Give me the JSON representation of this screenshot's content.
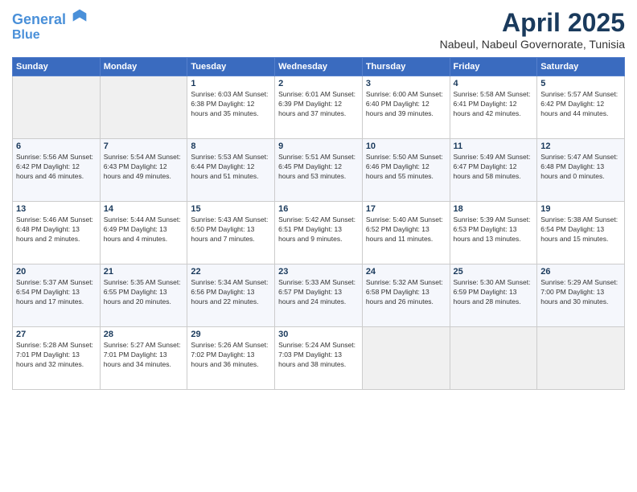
{
  "header": {
    "logo_line1": "General",
    "logo_line2": "Blue",
    "title": "April 2025",
    "subtitle": "Nabeul, Nabeul Governorate, Tunisia"
  },
  "days_of_week": [
    "Sunday",
    "Monday",
    "Tuesday",
    "Wednesday",
    "Thursday",
    "Friday",
    "Saturday"
  ],
  "weeks": [
    [
      {
        "num": "",
        "info": ""
      },
      {
        "num": "",
        "info": ""
      },
      {
        "num": "1",
        "info": "Sunrise: 6:03 AM\nSunset: 6:38 PM\nDaylight: 12 hours\nand 35 minutes."
      },
      {
        "num": "2",
        "info": "Sunrise: 6:01 AM\nSunset: 6:39 PM\nDaylight: 12 hours\nand 37 minutes."
      },
      {
        "num": "3",
        "info": "Sunrise: 6:00 AM\nSunset: 6:40 PM\nDaylight: 12 hours\nand 39 minutes."
      },
      {
        "num": "4",
        "info": "Sunrise: 5:58 AM\nSunset: 6:41 PM\nDaylight: 12 hours\nand 42 minutes."
      },
      {
        "num": "5",
        "info": "Sunrise: 5:57 AM\nSunset: 6:42 PM\nDaylight: 12 hours\nand 44 minutes."
      }
    ],
    [
      {
        "num": "6",
        "info": "Sunrise: 5:56 AM\nSunset: 6:42 PM\nDaylight: 12 hours\nand 46 minutes."
      },
      {
        "num": "7",
        "info": "Sunrise: 5:54 AM\nSunset: 6:43 PM\nDaylight: 12 hours\nand 49 minutes."
      },
      {
        "num": "8",
        "info": "Sunrise: 5:53 AM\nSunset: 6:44 PM\nDaylight: 12 hours\nand 51 minutes."
      },
      {
        "num": "9",
        "info": "Sunrise: 5:51 AM\nSunset: 6:45 PM\nDaylight: 12 hours\nand 53 minutes."
      },
      {
        "num": "10",
        "info": "Sunrise: 5:50 AM\nSunset: 6:46 PM\nDaylight: 12 hours\nand 55 minutes."
      },
      {
        "num": "11",
        "info": "Sunrise: 5:49 AM\nSunset: 6:47 PM\nDaylight: 12 hours\nand 58 minutes."
      },
      {
        "num": "12",
        "info": "Sunrise: 5:47 AM\nSunset: 6:48 PM\nDaylight: 13 hours\nand 0 minutes."
      }
    ],
    [
      {
        "num": "13",
        "info": "Sunrise: 5:46 AM\nSunset: 6:48 PM\nDaylight: 13 hours\nand 2 minutes."
      },
      {
        "num": "14",
        "info": "Sunrise: 5:44 AM\nSunset: 6:49 PM\nDaylight: 13 hours\nand 4 minutes."
      },
      {
        "num": "15",
        "info": "Sunrise: 5:43 AM\nSunset: 6:50 PM\nDaylight: 13 hours\nand 7 minutes."
      },
      {
        "num": "16",
        "info": "Sunrise: 5:42 AM\nSunset: 6:51 PM\nDaylight: 13 hours\nand 9 minutes."
      },
      {
        "num": "17",
        "info": "Sunrise: 5:40 AM\nSunset: 6:52 PM\nDaylight: 13 hours\nand 11 minutes."
      },
      {
        "num": "18",
        "info": "Sunrise: 5:39 AM\nSunset: 6:53 PM\nDaylight: 13 hours\nand 13 minutes."
      },
      {
        "num": "19",
        "info": "Sunrise: 5:38 AM\nSunset: 6:54 PM\nDaylight: 13 hours\nand 15 minutes."
      }
    ],
    [
      {
        "num": "20",
        "info": "Sunrise: 5:37 AM\nSunset: 6:54 PM\nDaylight: 13 hours\nand 17 minutes."
      },
      {
        "num": "21",
        "info": "Sunrise: 5:35 AM\nSunset: 6:55 PM\nDaylight: 13 hours\nand 20 minutes."
      },
      {
        "num": "22",
        "info": "Sunrise: 5:34 AM\nSunset: 6:56 PM\nDaylight: 13 hours\nand 22 minutes."
      },
      {
        "num": "23",
        "info": "Sunrise: 5:33 AM\nSunset: 6:57 PM\nDaylight: 13 hours\nand 24 minutes."
      },
      {
        "num": "24",
        "info": "Sunrise: 5:32 AM\nSunset: 6:58 PM\nDaylight: 13 hours\nand 26 minutes."
      },
      {
        "num": "25",
        "info": "Sunrise: 5:30 AM\nSunset: 6:59 PM\nDaylight: 13 hours\nand 28 minutes."
      },
      {
        "num": "26",
        "info": "Sunrise: 5:29 AM\nSunset: 7:00 PM\nDaylight: 13 hours\nand 30 minutes."
      }
    ],
    [
      {
        "num": "27",
        "info": "Sunrise: 5:28 AM\nSunset: 7:01 PM\nDaylight: 13 hours\nand 32 minutes."
      },
      {
        "num": "28",
        "info": "Sunrise: 5:27 AM\nSunset: 7:01 PM\nDaylight: 13 hours\nand 34 minutes."
      },
      {
        "num": "29",
        "info": "Sunrise: 5:26 AM\nSunset: 7:02 PM\nDaylight: 13 hours\nand 36 minutes."
      },
      {
        "num": "30",
        "info": "Sunrise: 5:24 AM\nSunset: 7:03 PM\nDaylight: 13 hours\nand 38 minutes."
      },
      {
        "num": "",
        "info": ""
      },
      {
        "num": "",
        "info": ""
      },
      {
        "num": "",
        "info": ""
      }
    ]
  ]
}
